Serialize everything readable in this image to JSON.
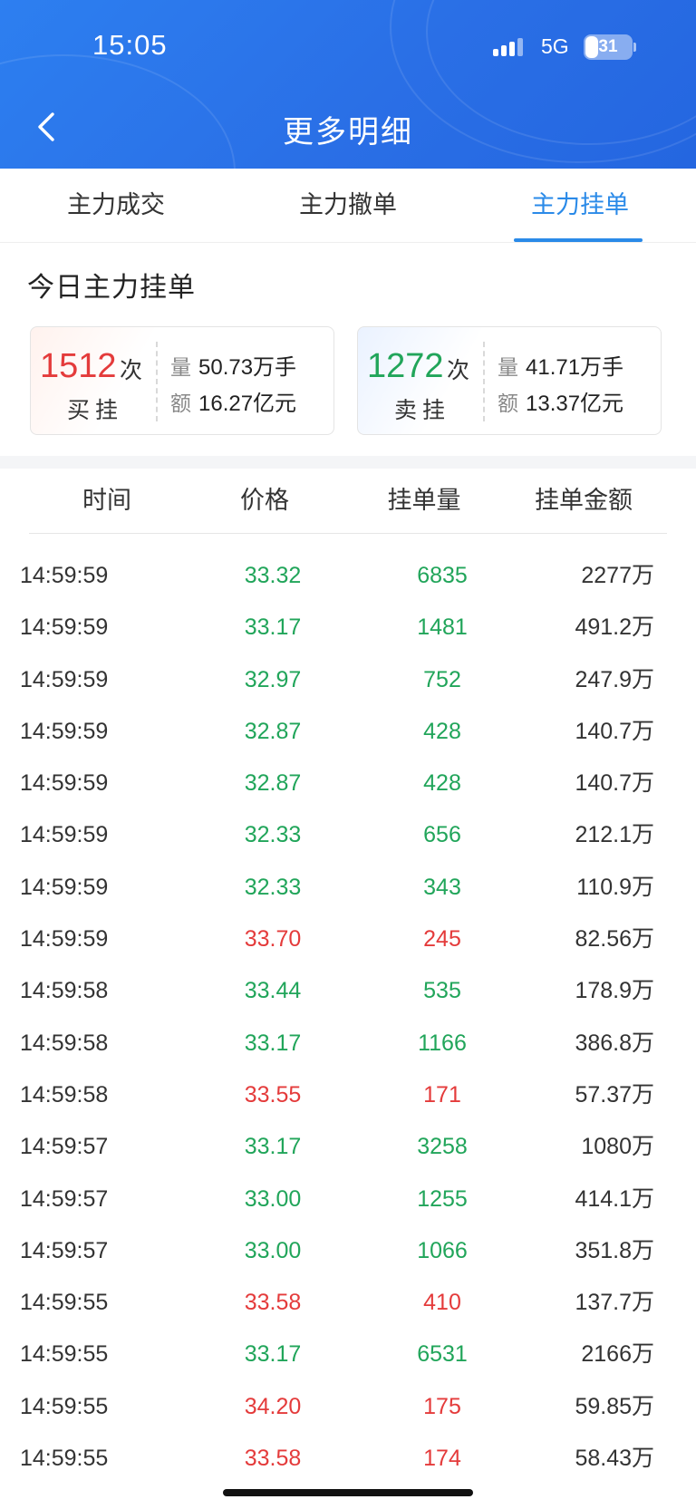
{
  "status_bar": {
    "time": "15:05",
    "network": "5G",
    "battery": "31"
  },
  "header": {
    "title": "更多明细"
  },
  "tabs": [
    {
      "label": "主力成交",
      "active": false
    },
    {
      "label": "主力撤单",
      "active": false
    },
    {
      "label": "主力挂单",
      "active": true
    }
  ],
  "summary": {
    "title": "今日主力挂单",
    "buy": {
      "count": "1512",
      "count_unit": "次",
      "label": "买挂",
      "volume_label": "量",
      "volume": "50.73万手",
      "amount_label": "额",
      "amount": "16.27亿元"
    },
    "sell": {
      "count": "1272",
      "count_unit": "次",
      "label": "卖挂",
      "volume_label": "量",
      "volume": "41.71万手",
      "amount_label": "额",
      "amount": "13.37亿元"
    }
  },
  "table": {
    "headers": [
      "时间",
      "价格",
      "挂单量",
      "挂单金额"
    ],
    "rows": [
      {
        "time": "14:59:59",
        "price": "33.32",
        "volume": "6835",
        "amount": "2277万",
        "side": "green"
      },
      {
        "time": "14:59:59",
        "price": "33.17",
        "volume": "1481",
        "amount": "491.2万",
        "side": "green"
      },
      {
        "time": "14:59:59",
        "price": "32.97",
        "volume": "752",
        "amount": "247.9万",
        "side": "green"
      },
      {
        "time": "14:59:59",
        "price": "32.87",
        "volume": "428",
        "amount": "140.7万",
        "side": "green"
      },
      {
        "time": "14:59:59",
        "price": "32.87",
        "volume": "428",
        "amount": "140.7万",
        "side": "green"
      },
      {
        "time": "14:59:59",
        "price": "32.33",
        "volume": "656",
        "amount": "212.1万",
        "side": "green"
      },
      {
        "time": "14:59:59",
        "price": "32.33",
        "volume": "343",
        "amount": "110.9万",
        "side": "green"
      },
      {
        "time": "14:59:59",
        "price": "33.70",
        "volume": "245",
        "amount": "82.56万",
        "side": "red"
      },
      {
        "time": "14:59:58",
        "price": "33.44",
        "volume": "535",
        "amount": "178.9万",
        "side": "green"
      },
      {
        "time": "14:59:58",
        "price": "33.17",
        "volume": "1166",
        "amount": "386.8万",
        "side": "green"
      },
      {
        "time": "14:59:58",
        "price": "33.55",
        "volume": "171",
        "amount": "57.37万",
        "side": "red"
      },
      {
        "time": "14:59:57",
        "price": "33.17",
        "volume": "3258",
        "amount": "1080万",
        "side": "green"
      },
      {
        "time": "14:59:57",
        "price": "33.00",
        "volume": "1255",
        "amount": "414.1万",
        "side": "green"
      },
      {
        "time": "14:59:57",
        "price": "33.00",
        "volume": "1066",
        "amount": "351.8万",
        "side": "green"
      },
      {
        "time": "14:59:55",
        "price": "33.58",
        "volume": "410",
        "amount": "137.7万",
        "side": "red"
      },
      {
        "time": "14:59:55",
        "price": "33.17",
        "volume": "6531",
        "amount": "2166万",
        "side": "green"
      },
      {
        "time": "14:59:55",
        "price": "34.20",
        "volume": "175",
        "amount": "59.85万",
        "side": "red"
      },
      {
        "time": "14:59:55",
        "price": "33.58",
        "volume": "174",
        "amount": "58.43万",
        "side": "red"
      }
    ]
  },
  "colors": {
    "header_blue": "#2a6fe6",
    "accent": "#2a8ae8",
    "up_red": "#e43b3b",
    "down_green": "#21a55a"
  }
}
